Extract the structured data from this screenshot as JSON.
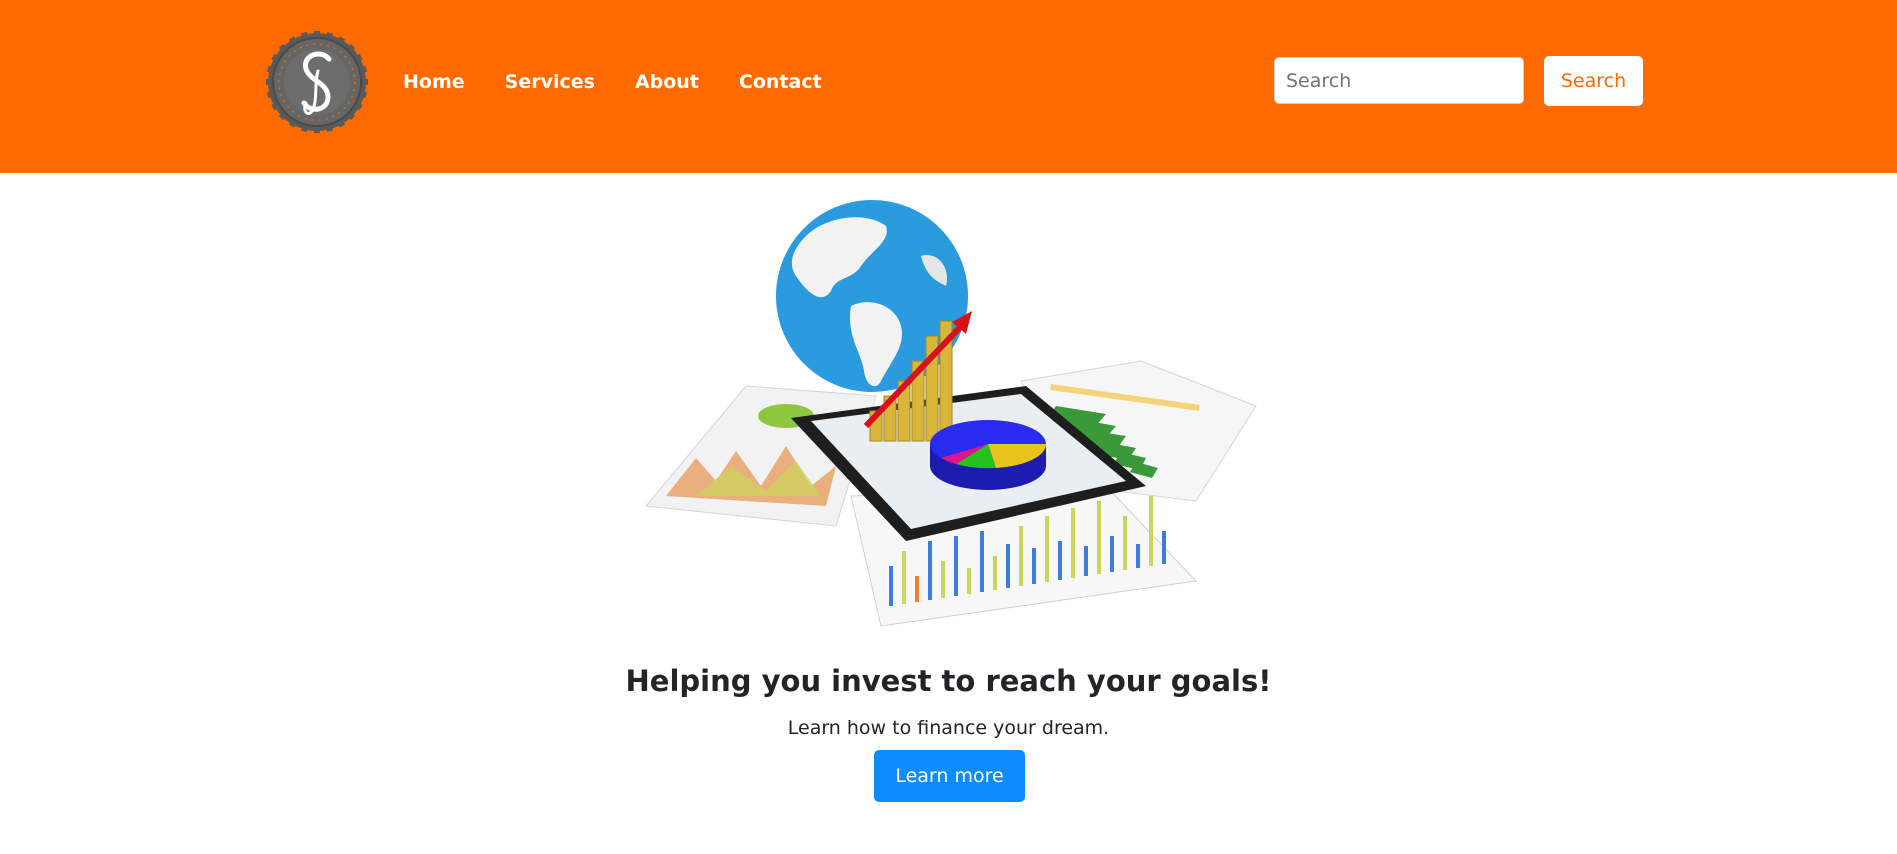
{
  "header": {
    "logo_icon": "s-monogram-badge-icon",
    "nav": [
      {
        "label": "Home"
      },
      {
        "label": "Services"
      },
      {
        "label": "About"
      },
      {
        "label": "Contact"
      }
    ],
    "search": {
      "placeholder": "Search",
      "value": "",
      "button_label": "Search"
    }
  },
  "hero": {
    "image": "globe-tablet-charts-illustration",
    "title": "Helping you invest to reach your goals!",
    "subtitle": "Learn how to finance your dream.",
    "cta_label": "Learn more"
  },
  "colors": {
    "brand": "#ff6a00",
    "primary": "#0d8bff",
    "text": "#212529"
  }
}
